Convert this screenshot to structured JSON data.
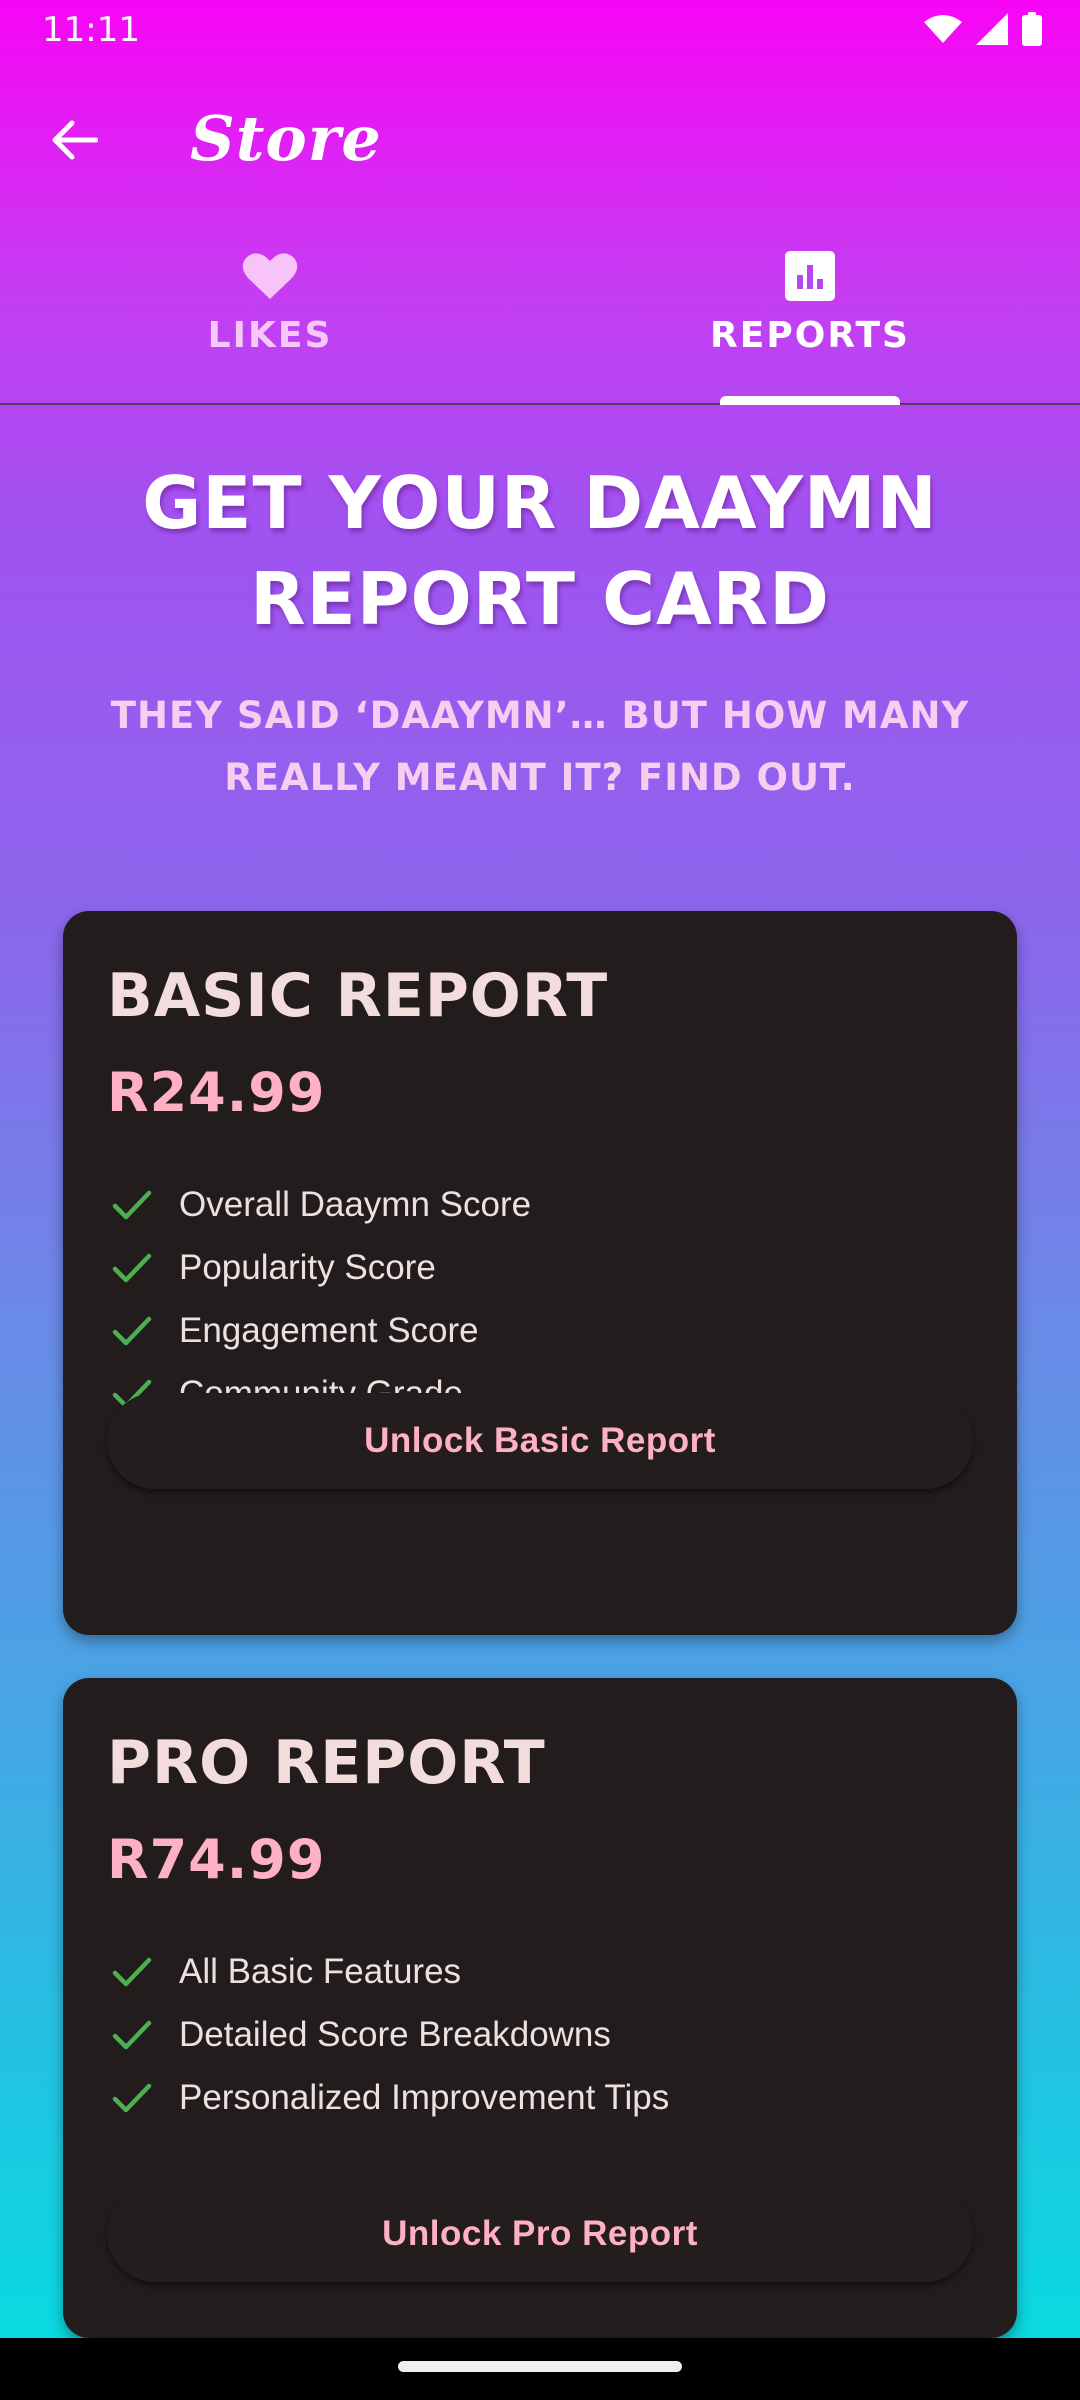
{
  "status_bar": {
    "time": "11:11"
  },
  "app_bar": {
    "title": "Store"
  },
  "tabs": [
    {
      "label": "LIKES",
      "icon": "heart-icon",
      "selected": false
    },
    {
      "label": "REPORTS",
      "icon": "bar-chart-icon",
      "selected": true
    }
  ],
  "promo": {
    "headline": "GET YOUR DAAYMN REPORT CARD",
    "subheadline": "THEY SAID ‘DAAYMN’… BUT HOW MANY REALLY MEANT IT? FIND OUT."
  },
  "plans": [
    {
      "title": "BASIC REPORT",
      "price": "R24.99",
      "features": [
        "Overall Daaymn Score",
        "Popularity Score",
        "Engagement Score",
        "Community Grade"
      ],
      "button_label": "Unlock Basic Report"
    },
    {
      "title": "PRO REPORT",
      "price": "R74.99",
      "features": [
        "All Basic Features",
        "Detailed Score Breakdowns",
        "Personalized Improvement Tips"
      ],
      "button_label": "Unlock Pro Report"
    }
  ],
  "colors": {
    "card_background": "#231c1d",
    "price": "#ffb1c4",
    "check": "#4caf50",
    "gradient_top": "#f805f5",
    "gradient_bottom": "#04dfe0"
  }
}
